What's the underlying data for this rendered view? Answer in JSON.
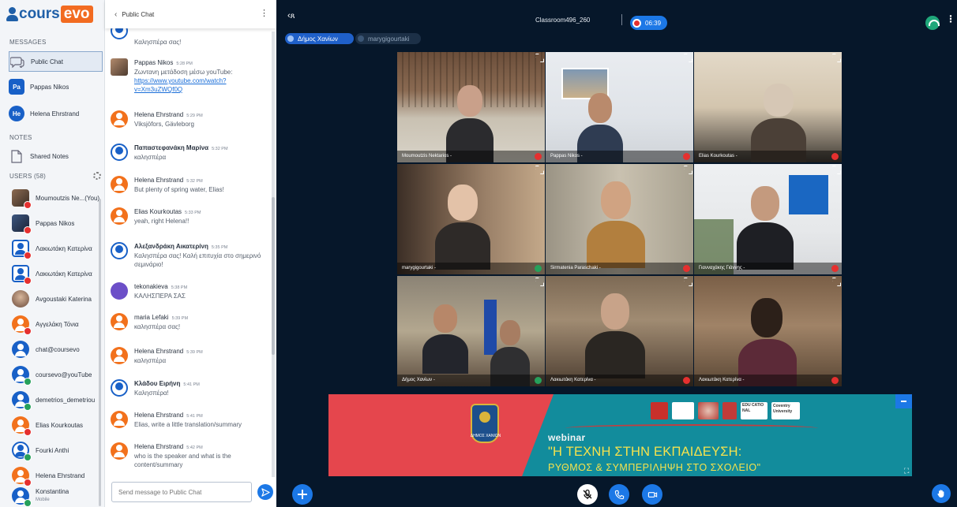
{
  "brand": {
    "pre": "cours",
    "post": "evo"
  },
  "sidebar": {
    "messages_heading": "MESSAGES",
    "public_chat": "Public Chat",
    "dm1": {
      "initials": "Pa",
      "name": "Pappas Nikos"
    },
    "dm2": {
      "initials": "He",
      "name": "Helena Ehrstrand"
    },
    "notes_heading": "NOTES",
    "shared_notes": "Shared Notes",
    "users_heading": "USERS (58)",
    "users": [
      {
        "name": "Moumoutzis Ne...(You)"
      },
      {
        "name": "Pappas Nikos"
      },
      {
        "name": "Λακιωτάκη Κατερίνα"
      },
      {
        "name": "Λακιωτάκη Κατερίνα"
      },
      {
        "name": "Avgoustaki Katerina"
      },
      {
        "name": "Αγγελάκη Τόνια"
      },
      {
        "name": "chat@coursevo"
      },
      {
        "name": "coursevo@youTube"
      },
      {
        "name": "demetrios_demetriou"
      },
      {
        "name": "Elias Kourkoutas"
      },
      {
        "name": "Fourki Anthi"
      },
      {
        "name": "Helena Ehrstrand"
      },
      {
        "name": "Konstantina",
        "sub": "Mobile"
      }
    ]
  },
  "chat": {
    "title": "Public Chat",
    "back": "‹",
    "messages": [
      {
        "name": "",
        "time": "",
        "text": "Καλησπέρα σας!"
      },
      {
        "name": "Pappas Nikos",
        "time": "5:28 PM",
        "text": "Ζωντανη μετάδοση μέσω youTube:",
        "link": "https://www.youtube.com/watch?v=Xm3uZWQf0Q"
      },
      {
        "name": "Helena Ehrstrand",
        "time": "5:29 PM",
        "text": "Viksjöfors, Gävleborg"
      },
      {
        "name": "Παπαστεφανάκη Μαρίνα",
        "time": "5:32 PM",
        "text": "καλησπέρα"
      },
      {
        "name": "Helena Ehrstrand",
        "time": "5:32 PM",
        "text": "But plenty of spring water, Elias!"
      },
      {
        "name": "Elias Kourkoutas",
        "time": "5:33 PM",
        "text": "yeah, right Helena!!"
      },
      {
        "name": "Αλεξανδράκη Αικατερίνη",
        "time": "5:35 PM",
        "text": "Καλησπέρα σας! Καλή επιτυχία στο σημερινό σεμινάριο!"
      },
      {
        "name": "tekonakieva",
        "time": "5:38 PM",
        "text": "ΚΑΛΗΣΠΕΡΑ ΣΑΣ"
      },
      {
        "name": "maria Lefaki",
        "time": "5:39 PM",
        "text": "καλησπέρα σας!"
      },
      {
        "name": "Helena Ehrstrand",
        "time": "5:39 PM",
        "text": "καλησπέρα"
      },
      {
        "name": "Κλάδου Ειρήνη",
        "time": "5:41 PM",
        "text": "Καλησπέρα!"
      },
      {
        "name": "Helena Ehrstrand",
        "time": "5:41 PM",
        "text": "Elias, write a little translation/summary"
      },
      {
        "name": "Helena Ehrstrand",
        "time": "5:42 PM",
        "text": "who is the speaker and what is the content/summary"
      }
    ],
    "input_placeholder": "Send message to Public Chat"
  },
  "session": {
    "room": "Classroom496_260",
    "timer": "06:39",
    "talkers": [
      "Δήμος Χανίων",
      "marygigourtaki"
    ]
  },
  "videos": [
    {
      "name": "Moumoutzis Nektarios -"
    },
    {
      "name": "Pappas Nikos -"
    },
    {
      "name": "Elias Kourkoutas -"
    },
    {
      "name": "marygigourtaki -"
    },
    {
      "name": "Sirmatenia Paraschaki -"
    },
    {
      "name": "Γιανναχάκης Γιάννης -"
    },
    {
      "name": "Δήμος Χανίων -"
    },
    {
      "name": "Λακιωτάκη Κατερίνα -"
    },
    {
      "name": "Λακιωτάκη Κατερίνα -"
    }
  ],
  "banner": {
    "crest_text": "ΔΗΜΟΣ ΧΑΝΙΩΝ",
    "webinar": "webinar",
    "line1": "\"Η ΤΕΧΝΗ ΣΤΗΝ ΕΚΠΑΙΔΕΥΣΗ:",
    "line2": "ΡΥΘΜΟΣ & ΣΥΜΠΕΡΙΛΗΨΗ ΣΤΟ ΣΧΟΛΕΙΟ\"",
    "logo_text_1": "EDU CATIO NAL",
    "logo_text_2": "Coventry University"
  },
  "colors": {
    "accent": "#1c78e6",
    "dark_bg": "#06172a",
    "orange": "#f2711c",
    "banner_teal": "#128c9c",
    "banner_red": "#e5464d"
  }
}
